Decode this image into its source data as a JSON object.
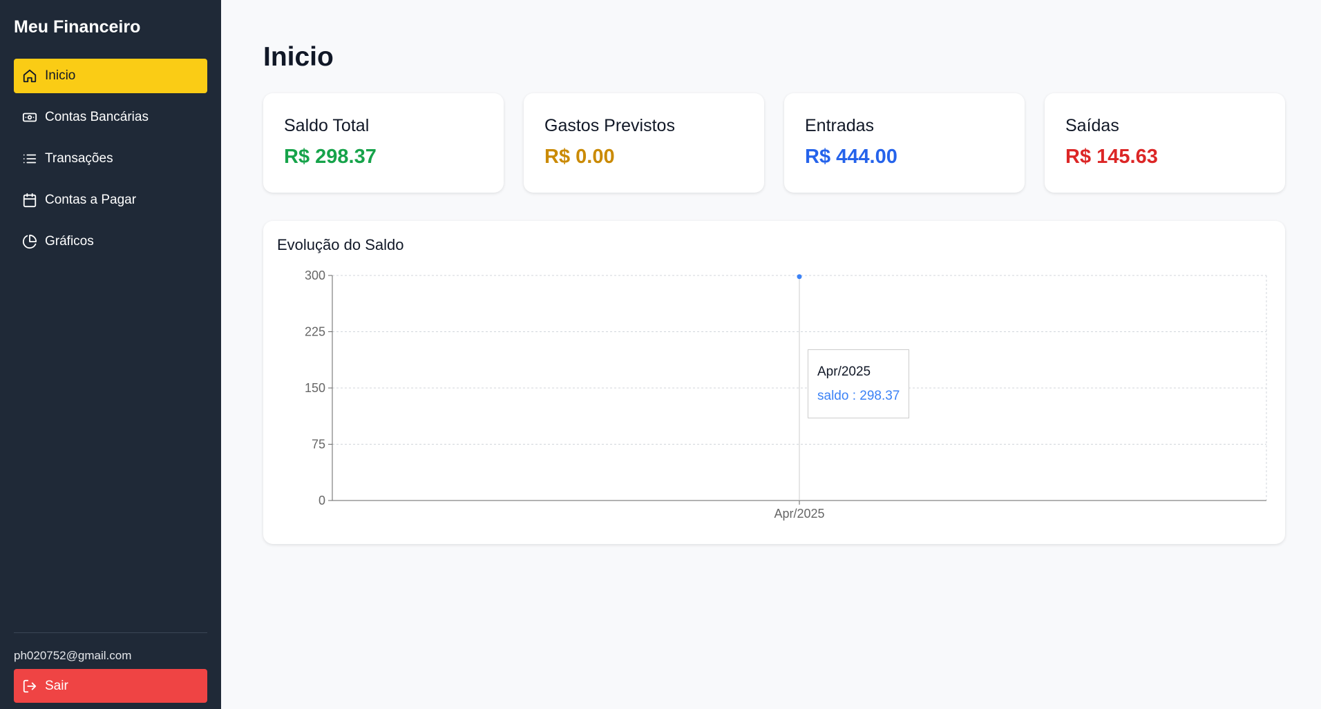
{
  "app": {
    "title": "Meu Financeiro"
  },
  "sidebar": {
    "items": [
      {
        "label": "Inicio",
        "icon": "home-icon",
        "active": true
      },
      {
        "label": "Contas Bancárias",
        "icon": "banknote-icon",
        "active": false
      },
      {
        "label": "Transações",
        "icon": "list-icon",
        "active": false
      },
      {
        "label": "Contas a Pagar",
        "icon": "calendar-icon",
        "active": false
      },
      {
        "label": "Gráficos",
        "icon": "pie-chart-icon",
        "active": false
      }
    ],
    "user_email": "ph020752@gmail.com",
    "logout_label": "Sair",
    "logout_icon": "logout-icon"
  },
  "main": {
    "page_title": "Inicio",
    "cards": [
      {
        "label": "Saldo Total",
        "value": "R$ 298.37",
        "color": "#16a34a"
      },
      {
        "label": "Gastos Previstos",
        "value": "R$ 0.00",
        "color": "#ca8a04"
      },
      {
        "label": "Entradas",
        "value": "R$ 444.00",
        "color": "#2563eb"
      },
      {
        "label": "Saídas",
        "value": "R$ 145.63",
        "color": "#dc2626"
      }
    ]
  },
  "colors": {
    "sidebar_bg": "#1f2937",
    "active_nav": "#facc15",
    "logout_bg": "#ef4444",
    "series": "#3b82f6"
  },
  "chart_data": {
    "type": "line",
    "title": "Evolução do Saldo",
    "categories": [
      "Apr/2025"
    ],
    "series": [
      {
        "name": "saldo",
        "values": [
          298.37
        ]
      }
    ],
    "yticks": [
      "0",
      "75",
      "150",
      "225",
      "300"
    ],
    "ylim": [
      0,
      300
    ],
    "grid": true,
    "tooltip": {
      "label": "Apr/2025",
      "text": "saldo : 298.37"
    }
  }
}
